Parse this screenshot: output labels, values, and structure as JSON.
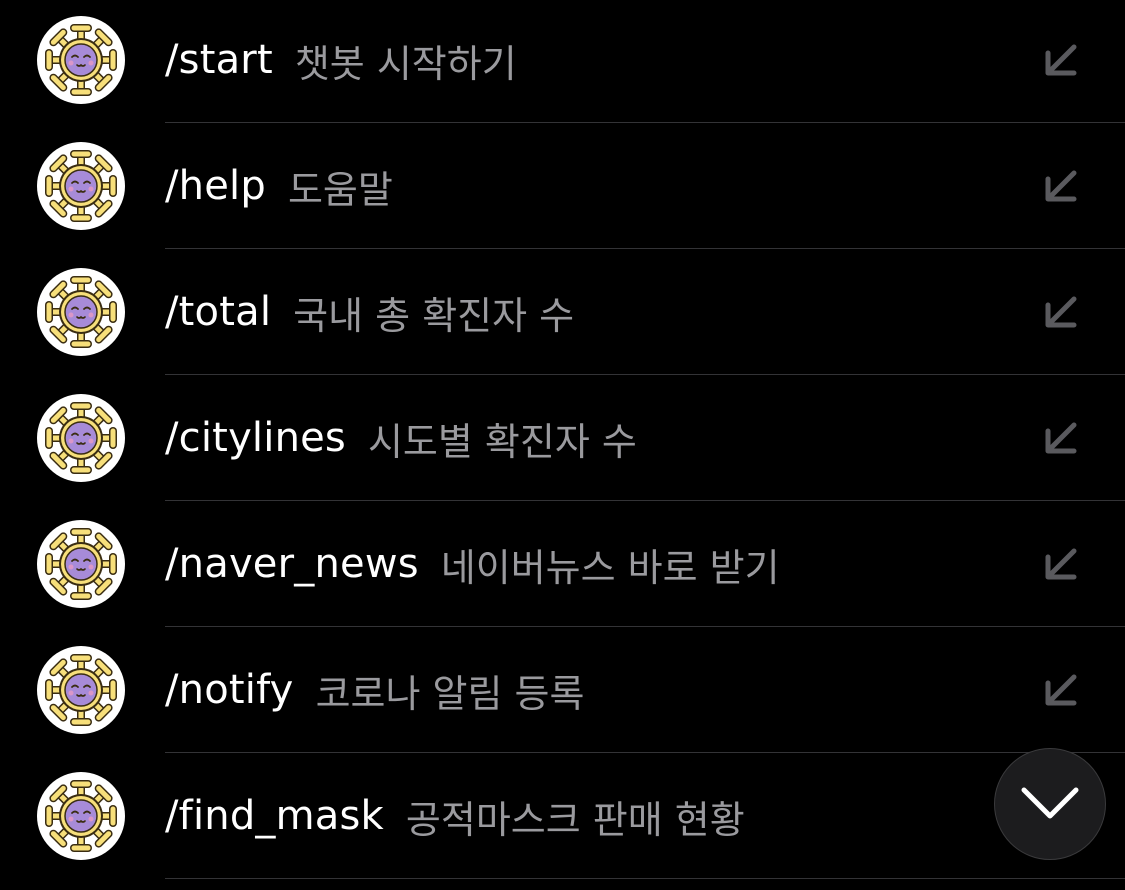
{
  "commands": [
    {
      "name": "/start",
      "description": "챗봇 시작하기",
      "avatar_icon": "virus-emoji-icon",
      "action_icon": "insert-arrow-icon"
    },
    {
      "name": "/help",
      "description": "도움말",
      "avatar_icon": "virus-emoji-icon",
      "action_icon": "insert-arrow-icon"
    },
    {
      "name": "/total",
      "description": "국내 총 확진자 수",
      "avatar_icon": "virus-emoji-icon",
      "action_icon": "insert-arrow-icon"
    },
    {
      "name": "/citylines",
      "description": "시도별 확진자 수",
      "avatar_icon": "virus-emoji-icon",
      "action_icon": "insert-arrow-icon"
    },
    {
      "name": "/naver_news",
      "description": "네이버뉴스 바로 받기",
      "avatar_icon": "virus-emoji-icon",
      "action_icon": "insert-arrow-icon"
    },
    {
      "name": "/notify",
      "description": "코로나 알림 등록",
      "avatar_icon": "virus-emoji-icon",
      "action_icon": "insert-arrow-icon"
    },
    {
      "name": "/find_mask",
      "description": "공적마스크 판매 현황",
      "avatar_icon": "virus-emoji-icon",
      "action_icon": "insert-arrow-icon"
    }
  ],
  "scroll_button": {
    "icon": "chevron-down-icon"
  },
  "colors": {
    "background": "#000000",
    "command_text": "#ffffff",
    "description_text": "#9a9a9e",
    "divider": "#333336",
    "avatar_spikes": "#f7df7a",
    "avatar_body": "#a78bd8",
    "scroll_button_bg": "#1c1c1e"
  }
}
